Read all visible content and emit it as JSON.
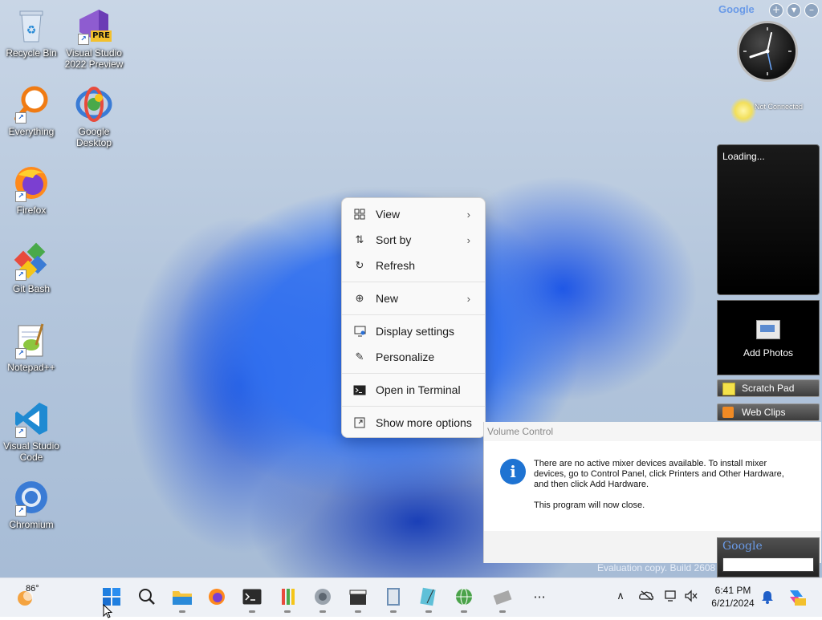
{
  "desktop_icons": [
    {
      "label": "Recycle Bin",
      "icon": "recycle-bin-icon"
    },
    {
      "label": "Visual Studio 2022 Preview",
      "icon": "visual-studio-icon",
      "badge": "PRE"
    },
    {
      "label": "Everything",
      "icon": "everything-search-icon"
    },
    {
      "label": "Google Desktop",
      "icon": "google-desktop-icon"
    },
    {
      "label": "Firefox",
      "icon": "firefox-icon"
    },
    {
      "label": "Git Bash",
      "icon": "git-bash-icon"
    },
    {
      "label": "Notepad++",
      "icon": "notepad-plus-plus-icon"
    },
    {
      "label": "Visual Studio Code",
      "icon": "vscode-icon"
    },
    {
      "label": "Chromium",
      "icon": "chromium-icon"
    }
  ],
  "context_menu": {
    "items": [
      {
        "label": "View",
        "icon": "grid-icon",
        "submenu": true
      },
      {
        "label": "Sort by",
        "icon": "sort-icon",
        "submenu": true
      },
      {
        "label": "Refresh",
        "icon": "refresh-icon",
        "submenu": false
      },
      {
        "label": "New",
        "icon": "plus-circle-icon",
        "submenu": true
      },
      {
        "label": "Display settings",
        "icon": "display-icon",
        "submenu": false
      },
      {
        "label": "Personalize",
        "icon": "brush-icon",
        "submenu": false
      },
      {
        "label": "Open in Terminal",
        "icon": "terminal-icon",
        "submenu": false
      },
      {
        "label": "Show more options",
        "icon": "expand-icon",
        "submenu": false
      }
    ]
  },
  "volume_dialog": {
    "title": "Volume Control",
    "message": "There are no active mixer devices available. To install mixer devices, go to Control Panel, click Printers and Other Hardware, and then click Add Hardware.",
    "note": "This program will now close."
  },
  "gadgets": {
    "sidebar_logo": "Google",
    "weather_status": "Not Connected",
    "slideshow_status": "Loading...",
    "photos_label": "Add Photos",
    "scratch_pad": "Scratch Pad",
    "web_clips": "Web Clips",
    "search_logo": "Google"
  },
  "watermark": "Evaluation copy. Build 2608",
  "taskbar": {
    "weather_temp": "86°",
    "time": "6:41 PM",
    "date": "6/21/2024",
    "more_label": "···"
  },
  "colors": {
    "accent": "#0067c0",
    "info": "#1e73d2"
  }
}
